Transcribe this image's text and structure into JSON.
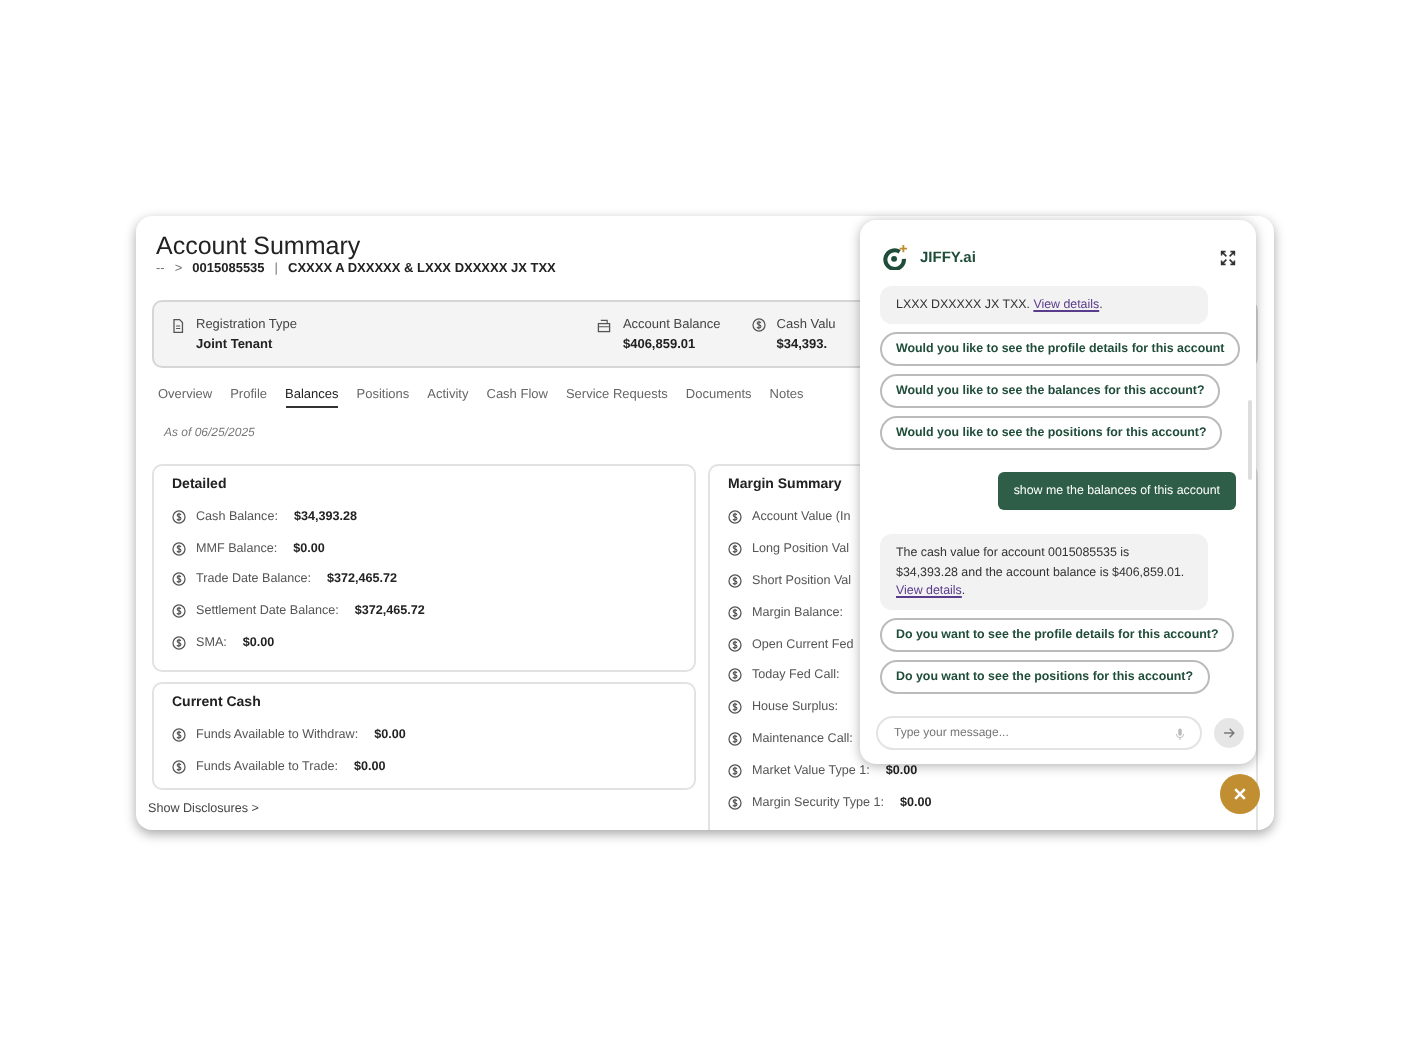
{
  "header": {
    "title": "Account Summary",
    "breadcrumb": {
      "root": "--",
      "chevron": ">",
      "account_number": "0015085535",
      "divider": "|",
      "account_name": "CXXXX A DXXXXX & LXXX DXXXXX JX TXX"
    }
  },
  "info": [
    {
      "kind": "document",
      "label": "Registration Type",
      "value": "Joint Tenant"
    },
    {
      "kind": "register",
      "label": "Account Balance",
      "value": "$406,859.01"
    },
    {
      "kind": "dollar",
      "label": "Cash Valu",
      "value": "$34,393."
    }
  ],
  "tabs": [
    {
      "label": "Overview",
      "selected": false
    },
    {
      "label": "Profile",
      "selected": false
    },
    {
      "label": "Balances",
      "selected": true
    },
    {
      "label": "Positions",
      "selected": false
    },
    {
      "label": "Activity",
      "selected": false
    },
    {
      "label": "Cash Flow",
      "selected": false
    },
    {
      "label": "Service Requests",
      "selected": false
    },
    {
      "label": "Documents",
      "selected": false
    },
    {
      "label": "Notes",
      "selected": false
    }
  ],
  "as_of": "As of 06/25/2025",
  "detailed": {
    "title": "Detailed",
    "rows": [
      {
        "label": "Cash Balance:",
        "value": "$34,393.28"
      },
      {
        "label": "MMF Balance:",
        "value": "$0.00"
      },
      {
        "label": "Trade Date Balance:",
        "value": "$372,465.72"
      },
      {
        "label": "Settlement Date Balance:",
        "value": "$372,465.72"
      },
      {
        "label": "SMA:",
        "value": "$0.00"
      }
    ]
  },
  "current_cash": {
    "title": "Current Cash",
    "rows": [
      {
        "label": "Funds Available to Withdraw:",
        "value": "$0.00"
      },
      {
        "label": "Funds Available to Trade:",
        "value": "$0.00"
      }
    ]
  },
  "margin_summary": {
    "title": "Margin Summary",
    "rows": [
      {
        "label": "Account Value (In"
      },
      {
        "label": "Long Position Val"
      },
      {
        "label": "Short Position Val"
      },
      {
        "label": "Margin Balance:"
      },
      {
        "label": "Open Current Fed"
      },
      {
        "label": "Today Fed Call:"
      },
      {
        "label": "House Surplus:"
      },
      {
        "label": "Maintenance Call:"
      },
      {
        "label": "Market Value Type 1:",
        "value": "$0.00"
      },
      {
        "label": "Margin Security Type 1:",
        "value": "$0.00"
      }
    ]
  },
  "disclosures_link": "Show Disclosures >",
  "chat": {
    "brand": "JIFFY.ai",
    "messages": [
      {
        "kind": "bot",
        "text": "LXXX DXXXXX JX TXX.",
        "link": "View details",
        "suffix": "."
      },
      {
        "kind": "suggestion",
        "text": "Would you like to see the profile details for this account"
      },
      {
        "kind": "suggestion",
        "text": "Would you like to see the balances for this account?"
      },
      {
        "kind": "suggestion",
        "text": "Would you like to see the positions for this account?"
      },
      {
        "kind": "user",
        "text": "show me the balances of this account"
      },
      {
        "kind": "bot",
        "text": "The cash value for account 0015085535 is $34,393.28 and the account balance is $406,859.01.",
        "link": "View details",
        "suffix": "."
      },
      {
        "kind": "suggestion",
        "text": "Do you want to see the profile details for this account?"
      },
      {
        "kind": "suggestion",
        "text": "Do you want to see the positions for this account?"
      }
    ],
    "input": {
      "placeholder": "Type your message..."
    }
  }
}
